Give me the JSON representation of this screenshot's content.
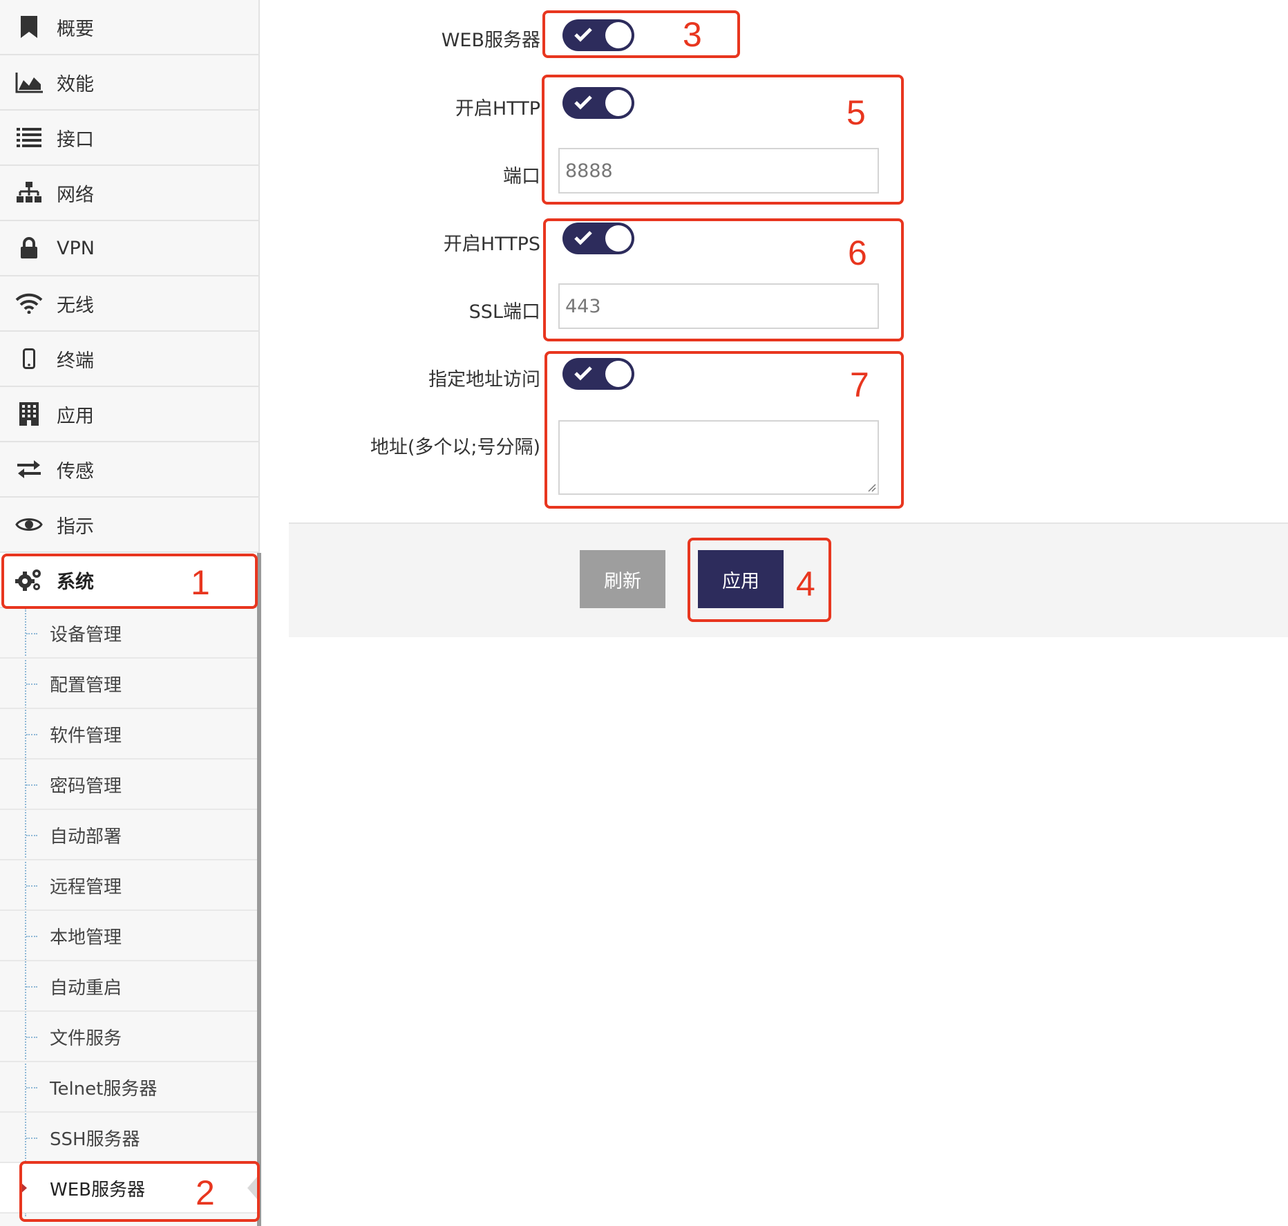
{
  "sidebar": {
    "items": [
      {
        "label": "概要",
        "icon": "bookmark-icon"
      },
      {
        "label": "效能",
        "icon": "area-chart-icon"
      },
      {
        "label": "接口",
        "icon": "list-icon"
      },
      {
        "label": "网络",
        "icon": "sitemap-icon"
      },
      {
        "label": "VPN",
        "icon": "lock-icon"
      },
      {
        "label": "无线",
        "icon": "wifi-icon"
      },
      {
        "label": "终端",
        "icon": "mobile-icon"
      },
      {
        "label": "应用",
        "icon": "building-icon"
      },
      {
        "label": "传感",
        "icon": "exchange-icon"
      },
      {
        "label": "指示",
        "icon": "eye-icon"
      },
      {
        "label": "系统",
        "icon": "gears-icon",
        "active": true
      }
    ],
    "subitems": [
      {
        "label": "设备管理"
      },
      {
        "label": "配置管理"
      },
      {
        "label": "软件管理"
      },
      {
        "label": "密码管理"
      },
      {
        "label": "自动部署"
      },
      {
        "label": "远程管理"
      },
      {
        "label": "本地管理"
      },
      {
        "label": "自动重启"
      },
      {
        "label": "文件服务"
      },
      {
        "label": "Telnet服务器"
      },
      {
        "label": "SSH服务器"
      },
      {
        "label": "WEB服务器",
        "active": true
      }
    ]
  },
  "form": {
    "web_server": {
      "label": "WEB服务器",
      "enabled": true
    },
    "http": {
      "label": "开启HTTP",
      "enabled": true
    },
    "port": {
      "label": "端口",
      "value": "8888"
    },
    "https": {
      "label": "开启HTTPS",
      "enabled": true
    },
    "ssl_port": {
      "label": "SSL端口",
      "value": "443"
    },
    "allowed_access": {
      "label": "指定地址访问",
      "enabled": true
    },
    "addresses": {
      "label": "地址(多个以;号分隔)",
      "value": ""
    }
  },
  "actions": {
    "refresh_label": "刷新",
    "apply_label": "应用"
  },
  "annotations": [
    "1",
    "2",
    "3",
    "4",
    "5",
    "6",
    "7"
  ],
  "colors": {
    "accent": "#2d2c5c",
    "annotation": "#e8361f",
    "refresh_button": "#9e9e9e"
  }
}
